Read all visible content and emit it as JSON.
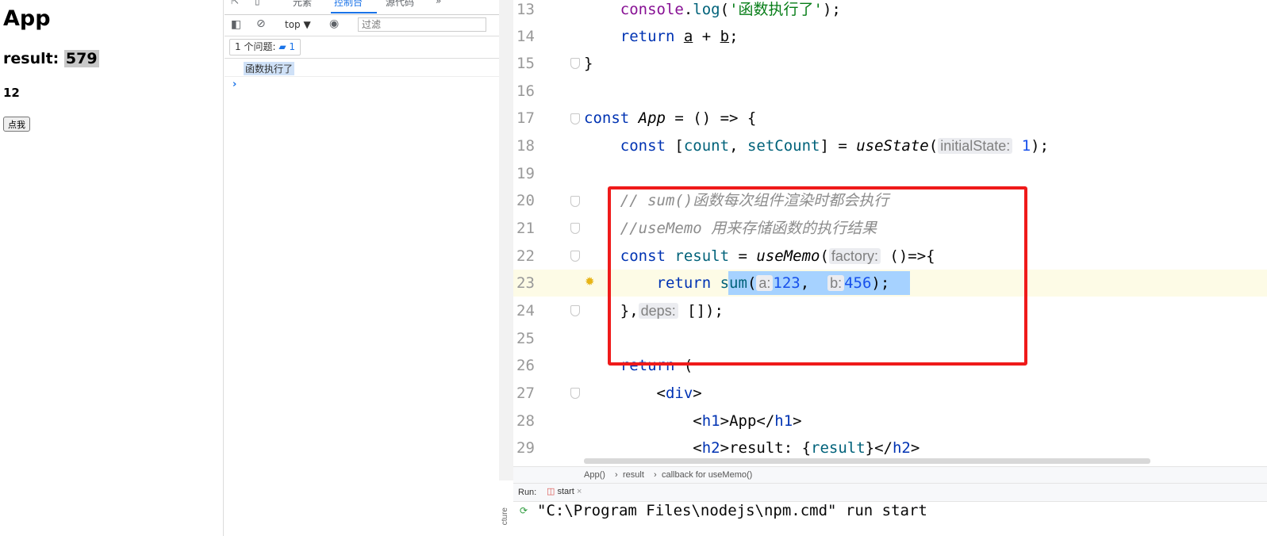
{
  "preview": {
    "title": "App",
    "result_label": "result:",
    "result_value": "579",
    "count": "12",
    "button_label": "点我"
  },
  "devtools": {
    "tabs": [
      "元素",
      "控制台",
      "源代码",
      "»"
    ],
    "active_tab": "控制台",
    "context": "top ▼",
    "filter_placeholder": "过滤",
    "issues_label": "1 个问题:",
    "issues_count": "1",
    "log_message": "函数执行了",
    "prompt": "›"
  },
  "editor": {
    "line_numbers": [
      "13",
      "14",
      "15",
      "16",
      "17",
      "18",
      "19",
      "20",
      "21",
      "22",
      "23",
      "24",
      "25",
      "26",
      "27",
      "28",
      "29"
    ],
    "lines": {
      "l13": {
        "indent": "    ",
        "obj": "console",
        "dot": ".",
        "fn": "log",
        "open": "(",
        "str": "'函数执行了'",
        "close": ");"
      },
      "l14": {
        "indent": "    ",
        "kw": "return",
        "sp": " ",
        "a": "a",
        "op": " + ",
        "b": "b",
        "end": ";"
      },
      "l15": {
        "text": "}"
      },
      "l17": {
        "kw": "const",
        "sp": " ",
        "name": "App",
        "rest": " = () => {"
      },
      "l18": {
        "indent": "    ",
        "kw": "const",
        "open": " [",
        "v1": "count",
        "comma": ", ",
        "v2": "setCount",
        "mid": "] = ",
        "fn": "useState",
        "paren": "(",
        "hint": "initialState:",
        "sp": " ",
        "num": "1",
        "close": ");"
      },
      "l20": {
        "indent": "    ",
        "comment": "// sum()函数每次组件渲染时都会执行"
      },
      "l21": {
        "indent": "    ",
        "comment": "//useMemo 用来存储函数的执行结果"
      },
      "l22": {
        "indent": "    ",
        "kw": "const",
        "sp": " ",
        "v": "result",
        "mid": " = ",
        "fn": "useMemo",
        "paren": "(",
        "hint": "factory:",
        "rest": " ()=>{"
      },
      "l23": {
        "indent": "        ",
        "kw": "return",
        "sp": " ",
        "fn": "sum",
        "paren": "(",
        "hint_a": "a:",
        "num_a": "123",
        "comma": ",  ",
        "hint_b": "b:",
        "num_b": "456",
        "close": ");"
      },
      "l24": {
        "indent": "    ",
        "start": "},",
        "hint": "deps:",
        "rest": " []);"
      },
      "l26": {
        "indent": "    ",
        "kw": "return",
        "rest": " ("
      },
      "l27": {
        "indent": "        ",
        "lt": "<",
        "tag": "div",
        "gt": ">"
      },
      "l28": {
        "indent": "            ",
        "lt": "<",
        "tag": "h1",
        "mid": ">App</",
        "tag2": "h1",
        "gt": ">"
      },
      "l29": {
        "indent": "            ",
        "lt": "<",
        "tag": "h2",
        "mid": ">result: {",
        "v": "result",
        "mid2": "}</",
        "tag2": "h2",
        "gt": ">"
      }
    }
  },
  "breadcrumb": [
    "App()",
    "result",
    "callback for useMemo()"
  ],
  "breadcrumb_sep": "›",
  "run": {
    "label": "Run:",
    "tab": "start",
    "close": "×",
    "command": "\"C:\\Program Files\\nodejs\\npm.cmd\" run start",
    "structure_label": "cture"
  }
}
